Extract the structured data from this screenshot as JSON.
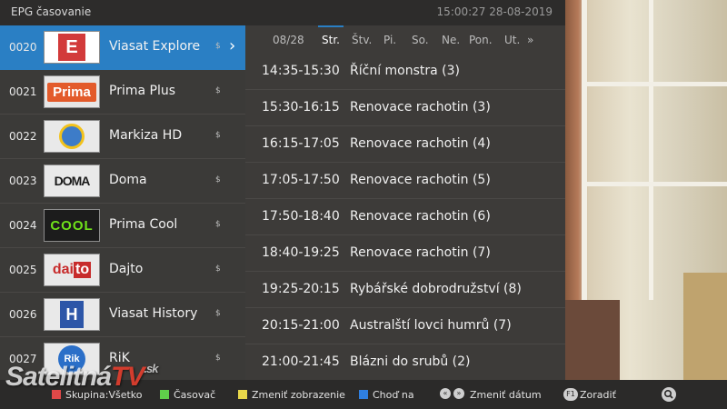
{
  "header": {
    "title": "EPG časovanie",
    "clock": "15:00:27 28-08-2019"
  },
  "channels": [
    {
      "number": "0020",
      "name": "Viasat Explore",
      "price_icon": "$",
      "logo_text": "E",
      "selected": true
    },
    {
      "number": "0021",
      "name": "Prima Plus",
      "price_icon": "$",
      "logo_text": "Prima"
    },
    {
      "number": "0022",
      "name": "Markiza HD",
      "price_icon": "$",
      "logo_text": ""
    },
    {
      "number": "0023",
      "name": "Doma",
      "price_icon": "$",
      "logo_text": "DOMA"
    },
    {
      "number": "0024",
      "name": "Prima Cool",
      "price_icon": "$",
      "logo_text": "COOL"
    },
    {
      "number": "0025",
      "name": "Dajto",
      "price_icon": "$",
      "logo_text_a": "dai",
      "logo_text_b": "to"
    },
    {
      "number": "0026",
      "name": "Viasat History",
      "price_icon": "$",
      "logo_text": "H"
    },
    {
      "number": "0027",
      "name": "RiK",
      "price_icon": "$",
      "logo_text": "Rik"
    }
  ],
  "datebar": {
    "date": "08/28",
    "days": [
      "Str.",
      "Štv.",
      "Pi.",
      "So.",
      "Ne.",
      "Pon.",
      "Ut."
    ],
    "selected_day": "Str.",
    "next_icon": "»"
  },
  "programs": [
    {
      "time": "14:35-15:30",
      "title": "Říční monstra (3)"
    },
    {
      "time": "15:30-16:15",
      "title": "Renovace rachotin (3)"
    },
    {
      "time": "16:15-17:05",
      "title": "Renovace rachotin (4)"
    },
    {
      "time": "17:05-17:50",
      "title": "Renovace rachotin (5)"
    },
    {
      "time": "17:50-18:40",
      "title": "Renovace rachotin (6)"
    },
    {
      "time": "18:40-19:25",
      "title": "Renovace rachotin (7)"
    },
    {
      "time": "19:25-20:15",
      "title": "Rybářské dobrodružství (8)"
    },
    {
      "time": "20:15-21:00",
      "title": "Australští lovci humrů (7)"
    },
    {
      "time": "21:00-21:45",
      "title": "Blázni do srubů (2)"
    }
  ],
  "bottom_hints": {
    "red": "Skupina:Všetko",
    "green": "Časovač",
    "yellow": "Zmeniť zobrazenie",
    "blue": "Choď na",
    "change_date": "Zmeniť dátum",
    "sort_key": "F1",
    "sort": "Zoradiť"
  },
  "colors": {
    "red": "#e04848",
    "green": "#5fcf4a",
    "yellow": "#e8d84a",
    "blue": "#2f7fe0",
    "selection": "#2a7fc4"
  },
  "watermark": {
    "main": "Satelitná",
    "tv": "TV",
    "suffix": ".sk"
  }
}
